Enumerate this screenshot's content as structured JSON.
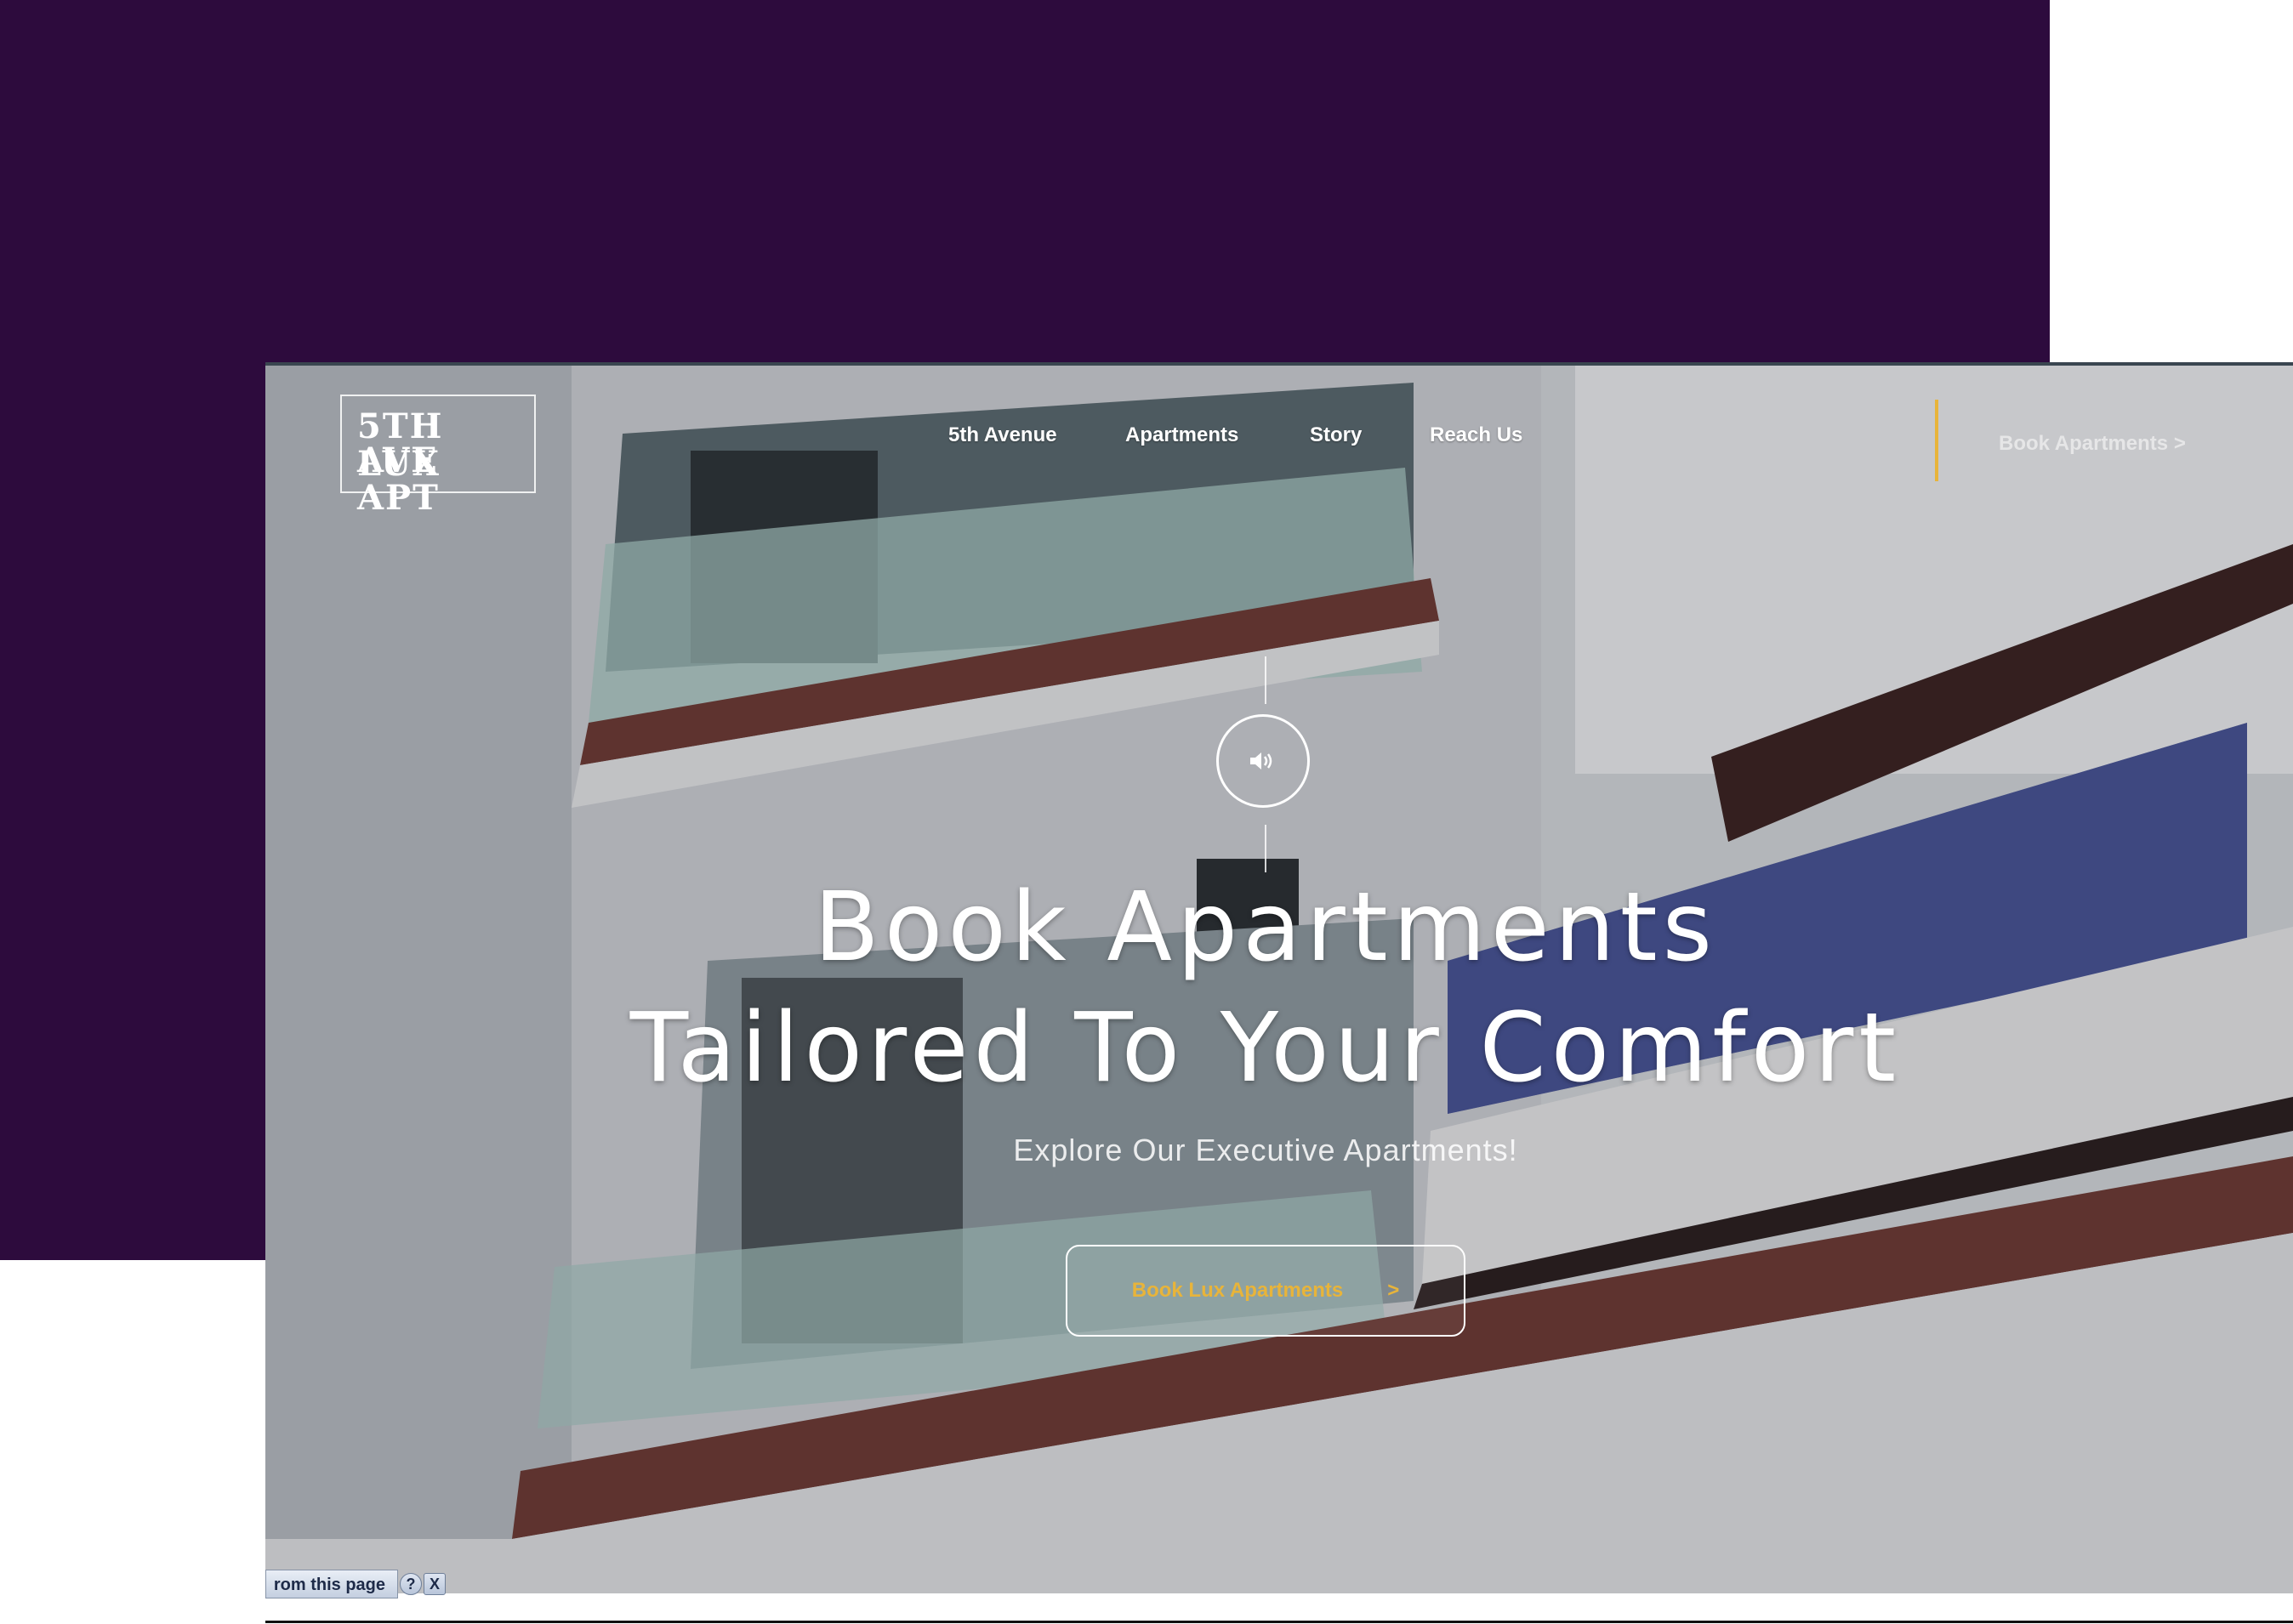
{
  "logo": {
    "line1": "5TH AVE",
    "line2": "LUX APT"
  },
  "nav": {
    "items": [
      "5th Avenue",
      "Apartments",
      "Story",
      "Reach Us"
    ]
  },
  "header_cta": {
    "label": "Book Apartments",
    "chevron": ">"
  },
  "hero": {
    "title_line1": "Book Apartments",
    "title_line2": "Tailored To Your Comfort",
    "subtitle": "Explore Our Executive Apartments!",
    "cta_label": "Book Lux Apartments",
    "cta_chevron": ">"
  },
  "sound_button": {
    "icon": "speaker-icon"
  },
  "status_bar": {
    "text": "rom this page",
    "help": "?",
    "close": "X"
  },
  "colors": {
    "background_purple": "#2d0b3d",
    "accent_gold": "#e8b43a",
    "text_white": "#ffffff"
  }
}
